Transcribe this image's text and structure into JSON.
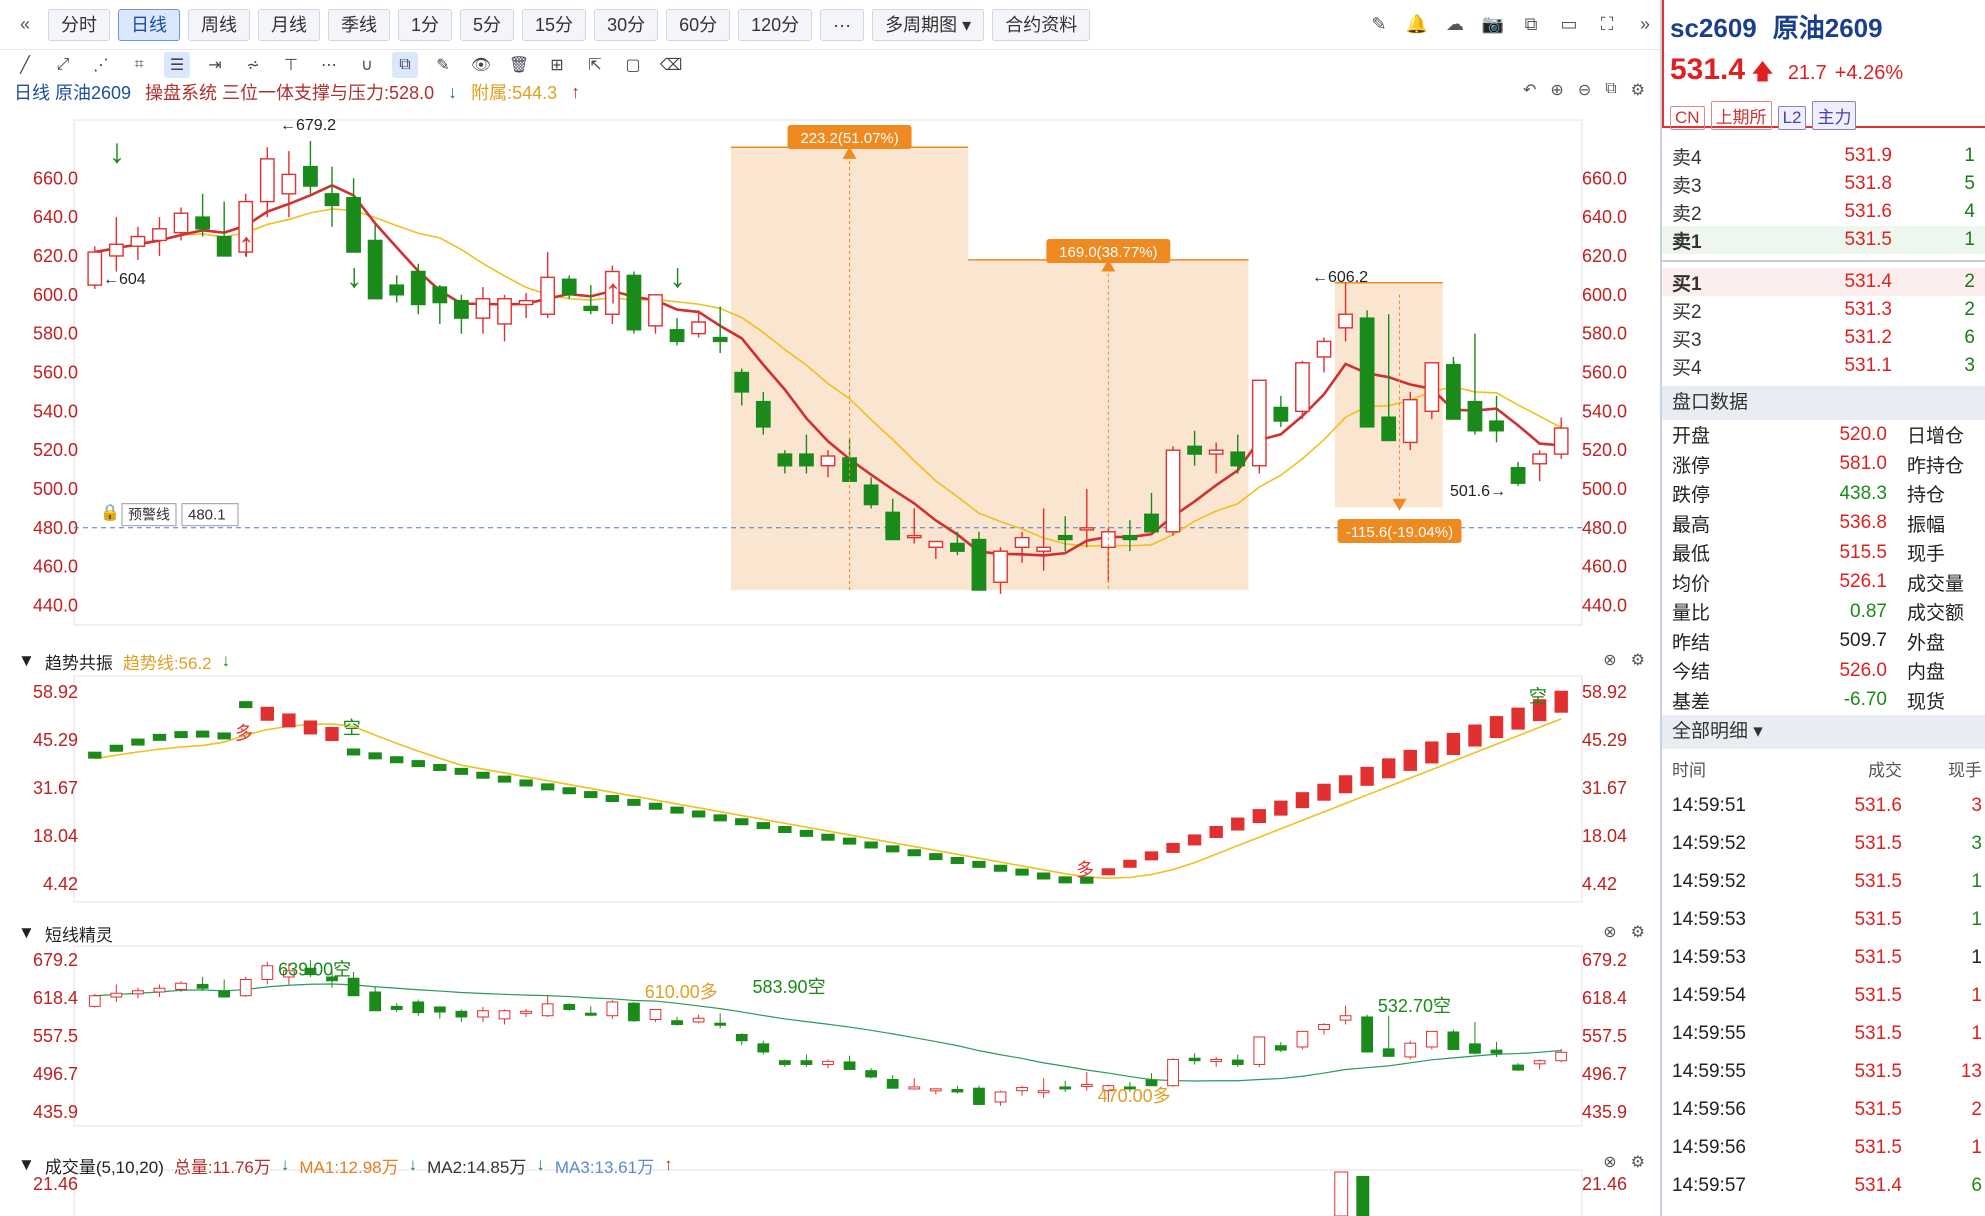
{
  "toolbar": {
    "periods": [
      "分时",
      "日线",
      "周线",
      "月线",
      "季线",
      "1分",
      "5分",
      "15分",
      "30分",
      "60分",
      "120分",
      "···",
      "多周期图 ▾",
      "合约资料"
    ],
    "active": "日线"
  },
  "info": {
    "title": "日线 原油2609",
    "system": "操盘系统 三位一体支撑与压力:528.0",
    "attach": "附属:544.3"
  },
  "price_axis": {
    "labels": [
      "660.0",
      "640.0",
      "620.0",
      "600.0",
      "580.0",
      "560.0",
      "540.0",
      "520.0",
      "500.0",
      "480.0",
      "460.0",
      "440.0"
    ]
  },
  "annotations": {
    "high": "←679.2",
    "low_left": "←604",
    "peak_right": "←606.2",
    "low_right": "501.6→",
    "alert_label": "预警线",
    "alert_value": "480.1",
    "box1": "223.2(51.07%)",
    "box2": "169.0(38.77%)",
    "box3": "-115.6(-19.04%)"
  },
  "trend": {
    "title": "趋势共振",
    "line": "趋势线:56.2",
    "labels": [
      "58.92",
      "45.29",
      "31.67",
      "18.04",
      "4.42"
    ],
    "marks": {
      "duo1": "多",
      "kong1": "空",
      "duo2": "多",
      "kong2": "空"
    }
  },
  "short": {
    "title": "短线精灵",
    "labels": [
      "679.2",
      "618.4",
      "557.5",
      "496.7",
      "435.9"
    ],
    "marks": {
      "m1": "639.00空",
      "m2": "610.00多",
      "m3": "583.90空",
      "m4": "532.70空",
      "m5": "470.00多"
    }
  },
  "volume": {
    "title": "成交量(5,10,20)",
    "total": "总量:11.76万",
    "ma1": "MA1:12.98万",
    "ma2": "MA2:14.85万",
    "ma3": "MA3:13.61万",
    "label": "21.46"
  },
  "quote": {
    "code": "sc2609",
    "name": "原油2609",
    "price": "531.4",
    "change": "21.7",
    "pct": "+4.26%",
    "tags": [
      "CN",
      "上期所",
      "L2",
      "主力"
    ],
    "sell": [
      {
        "l": "卖4",
        "p": "531.9",
        "v": "1"
      },
      {
        "l": "卖3",
        "p": "531.8",
        "v": "5"
      },
      {
        "l": "卖2",
        "p": "531.6",
        "v": "4"
      },
      {
        "l": "卖1",
        "p": "531.5",
        "v": "1"
      }
    ],
    "buy": [
      {
        "l": "买1",
        "p": "531.4",
        "v": "2"
      },
      {
        "l": "买2",
        "p": "531.3",
        "v": "2"
      },
      {
        "l": "买3",
        "p": "531.2",
        "v": "6"
      },
      {
        "l": "买4",
        "p": "531.1",
        "v": "3"
      }
    ],
    "panel_title": "盘口数据",
    "panel": [
      {
        "l": "开盘",
        "v": "520.0",
        "c": "red",
        "l2": "日增仓"
      },
      {
        "l": "涨停",
        "v": "581.0",
        "c": "red",
        "l2": "昨持仓"
      },
      {
        "l": "跌停",
        "v": "438.3",
        "c": "green",
        "l2": "持仓"
      },
      {
        "l": "最高",
        "v": "536.8",
        "c": "red",
        "l2": "振幅"
      },
      {
        "l": "最低",
        "v": "515.5",
        "c": "red",
        "l2": "现手"
      },
      {
        "l": "均价",
        "v": "526.1",
        "c": "red",
        "l2": "成交量"
      },
      {
        "l": "量比",
        "v": "0.87",
        "c": "green",
        "l2": "成交额"
      },
      {
        "l": "昨结",
        "v": "509.7",
        "c": "blk",
        "l2": "外盘"
      },
      {
        "l": "今结",
        "v": "526.0",
        "c": "red",
        "l2": "内盘"
      },
      {
        "l": "基差",
        "v": "-6.70",
        "c": "green",
        "l2": "现货"
      }
    ],
    "detail_title": "全部明细 ▾",
    "detail_cols": [
      "时间",
      "成交",
      "现手"
    ],
    "trades": [
      {
        "t": "14:59:51",
        "p": "531.6",
        "v": "3",
        "c": "red"
      },
      {
        "t": "14:59:52",
        "p": "531.5",
        "v": "3",
        "c": "green"
      },
      {
        "t": "14:59:52",
        "p": "531.5",
        "v": "1",
        "c": "green"
      },
      {
        "t": "14:59:53",
        "p": "531.5",
        "v": "1",
        "c": "green"
      },
      {
        "t": "14:59:53",
        "p": "531.5",
        "v": "1",
        "c": "blk"
      },
      {
        "t": "14:59:54",
        "p": "531.5",
        "v": "1",
        "c": "red"
      },
      {
        "t": "14:59:55",
        "p": "531.5",
        "v": "1",
        "c": "red"
      },
      {
        "t": "14:59:55",
        "p": "531.5",
        "v": "13",
        "c": "red"
      },
      {
        "t": "14:59:56",
        "p": "531.5",
        "v": "2",
        "c": "red"
      },
      {
        "t": "14:59:56",
        "p": "531.5",
        "v": "1",
        "c": "red"
      },
      {
        "t": "14:59:57",
        "p": "531.4",
        "v": "6",
        "c": "green"
      }
    ]
  },
  "colors": {
    "up": "#e03030",
    "down": "#1a8a1a",
    "ma_red": "#d03030",
    "ma_yellow": "#f0c020",
    "box": "#f7dcc0",
    "accent": "#ee8a20"
  },
  "chart_data": {
    "type": "candlestick",
    "title": "日线 原油2609",
    "ohlc": [
      [
        605,
        625,
        603,
        622
      ],
      [
        620,
        640,
        612,
        626
      ],
      [
        625,
        635,
        618,
        630
      ],
      [
        628,
        640,
        620,
        634
      ],
      [
        632,
        645,
        628,
        642
      ],
      [
        640,
        652,
        630,
        634
      ],
      [
        630,
        648,
        626,
        620
      ],
      [
        622,
        652,
        620,
        648
      ],
      [
        648,
        676,
        640,
        670
      ],
      [
        652,
        674,
        640,
        662
      ],
      [
        666,
        679.2,
        652,
        656
      ],
      [
        652,
        666,
        635,
        646
      ],
      [
        650,
        660,
        632,
        622
      ],
      [
        628,
        636,
        598,
        598
      ],
      [
        605,
        610,
        596,
        600
      ],
      [
        612,
        616,
        590,
        595
      ],
      [
        604,
        605,
        585,
        596
      ],
      [
        597,
        600,
        580,
        588
      ],
      [
        588,
        604,
        580,
        598
      ],
      [
        585,
        600,
        576,
        598
      ],
      [
        595,
        601,
        588,
        597
      ],
      [
        590,
        622,
        588,
        609
      ],
      [
        608,
        610,
        598,
        600
      ],
      [
        594,
        605,
        590,
        592
      ],
      [
        590,
        615,
        585,
        612
      ],
      [
        610,
        612,
        580,
        582
      ],
      [
        584,
        600,
        580,
        600
      ],
      [
        582,
        588,
        574,
        576
      ],
      [
        580,
        592,
        578,
        586
      ],
      [
        578,
        594,
        570,
        576
      ],
      [
        560,
        562,
        543,
        550
      ],
      [
        545,
        550,
        528,
        532
      ],
      [
        518,
        520,
        508,
        512
      ],
      [
        518,
        528,
        508,
        512
      ],
      [
        512,
        520,
        506,
        517
      ],
      [
        516,
        526,
        505,
        504
      ],
      [
        502,
        506,
        490,
        492
      ],
      [
        488,
        495,
        474,
        474
      ],
      [
        476,
        490,
        472,
        476
      ],
      [
        470,
        472,
        464,
        473
      ],
      [
        472,
        478,
        466,
        468
      ],
      [
        474,
        478,
        458,
        448
      ],
      [
        452,
        470,
        446,
        468
      ],
      [
        470,
        478,
        462,
        475
      ],
      [
        468,
        490,
        458,
        470
      ],
      [
        476,
        486,
        468,
        474
      ],
      [
        480,
        500,
        470,
        480
      ],
      [
        470,
        480,
        452,
        478
      ],
      [
        476,
        484,
        468,
        474
      ],
      [
        487,
        498,
        480,
        478
      ],
      [
        478,
        522,
        476,
        520
      ],
      [
        522,
        530,
        512,
        518
      ],
      [
        518,
        524,
        508,
        520
      ],
      [
        519,
        528,
        508,
        512
      ],
      [
        512,
        554,
        508,
        556
      ],
      [
        542,
        548,
        532,
        535
      ],
      [
        540,
        566,
        536,
        565
      ],
      [
        568,
        578,
        560,
        576
      ],
      [
        583,
        606.2,
        576,
        590
      ],
      [
        588,
        592,
        540,
        532
      ],
      [
        537,
        590,
        530,
        525
      ],
      [
        524,
        550,
        520,
        546
      ],
      [
        540,
        560,
        536,
        565
      ],
      [
        564,
        568,
        540,
        536
      ],
      [
        545,
        580,
        528,
        530
      ],
      [
        535,
        548,
        524,
        530
      ],
      [
        511,
        514,
        501.6,
        503
      ],
      [
        513,
        520,
        504,
        518
      ],
      [
        518,
        536.8,
        515.5,
        531.4
      ]
    ],
    "ylim": [
      430,
      690
    ],
    "y_ticks": [
      660,
      640,
      620,
      600,
      580,
      560,
      540,
      520,
      500,
      480,
      460,
      440
    ],
    "alert": 480.1
  }
}
